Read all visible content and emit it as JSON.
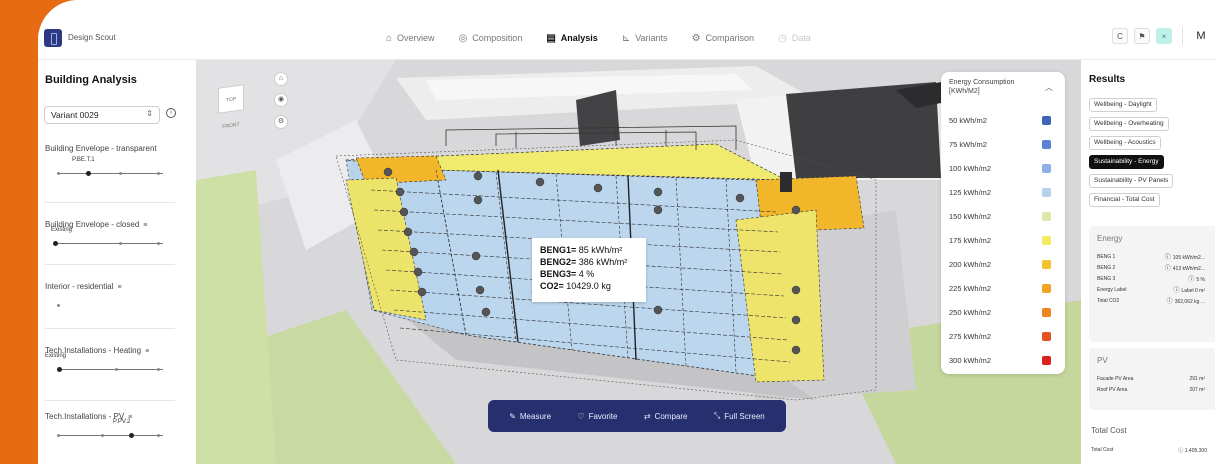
{
  "brand": {
    "name": "Design Scout"
  },
  "nav": [
    {
      "label": "Overview",
      "icon": "home-icon",
      "glyph": "⌂",
      "state": "normal"
    },
    {
      "label": "Composition",
      "icon": "layers-icon",
      "glyph": "◎",
      "state": "normal"
    },
    {
      "label": "Analysis",
      "icon": "analysis-icon",
      "glyph": "▤",
      "state": "active"
    },
    {
      "label": "Variants",
      "icon": "chart-icon",
      "glyph": "⊾",
      "state": "normal"
    },
    {
      "label": "Comparison",
      "icon": "compare-icon",
      "glyph": "⚙",
      "state": "normal"
    },
    {
      "label": "Data",
      "icon": "clock-icon",
      "glyph": "◷",
      "state": "disabled"
    }
  ],
  "toolbar": {
    "refresh": "C",
    "flag": "⚑",
    "close": "×",
    "user_initial": "M"
  },
  "left_panel": {
    "title": "Building Analysis",
    "variant": "Variant 0029",
    "params": [
      {
        "label": "Building Envelope - transparent",
        "value": "P.BE.T.1"
      },
      {
        "label": "Building Envelope - closed",
        "value": "Existing"
      },
      {
        "label": "Interior - residential",
        "value": ""
      },
      {
        "label": "Tech.Installations - Heating",
        "value": "Existing"
      },
      {
        "label": "Tech.Installations - PV",
        "value": "P.PV.2"
      }
    ]
  },
  "viewport": {
    "cube_label": "TOP FRONT",
    "tooltip": {
      "lines": [
        {
          "key": "BENG1=",
          "value": "85 kWh/m²"
        },
        {
          "key": "BENG2=",
          "value": "386 kWh/m²"
        },
        {
          "key": "BENG3=",
          "value": "4 %"
        },
        {
          "key": "CO2=",
          "value": "10429.0 kg"
        }
      ]
    },
    "legend": {
      "title": "Energy Consumption [KWh/M2]",
      "items": [
        {
          "label": "50 kWh/m2",
          "color": "#3f63b5"
        },
        {
          "label": "75 kWh/m2",
          "color": "#5b82d2"
        },
        {
          "label": "100 kWh/m2",
          "color": "#8fb0e6"
        },
        {
          "label": "125 kWh/m2",
          "color": "#b4d2ec"
        },
        {
          "label": "150 kWh/m2",
          "color": "#dce8a8"
        },
        {
          "label": "175 kWh/m2",
          "color": "#f2ec62"
        },
        {
          "label": "200 kWh/m2",
          "color": "#f3c22e"
        },
        {
          "label": "225 kWh/m2",
          "color": "#f1a524"
        },
        {
          "label": "250 kWh/m2",
          "color": "#ed8420"
        },
        {
          "label": "275 kWh/m2",
          "color": "#e3531d"
        },
        {
          "label": "300 kWh/m2",
          "color": "#d9231c"
        }
      ]
    },
    "actions": [
      {
        "label": "Measure",
        "icon": "ruler-icon",
        "glyph": "✎"
      },
      {
        "label": "Favorite",
        "icon": "heart-icon",
        "glyph": "♡"
      },
      {
        "label": "Compare",
        "icon": "compare-icon",
        "glyph": "⇄"
      },
      {
        "label": "Full Screen",
        "icon": "fullscreen-icon",
        "glyph": "⤡"
      }
    ]
  },
  "right_panel": {
    "title": "Results",
    "chips": [
      {
        "label": "Wellbeing - Daylight",
        "active": false
      },
      {
        "label": "Wellbeing - Overheating",
        "active": false
      },
      {
        "label": "Wellbeing - Acoustics",
        "active": false
      },
      {
        "label": "Sustainability - Energy",
        "active": true
      },
      {
        "label": "Sustainability - PV Panels",
        "active": false
      },
      {
        "label": "Financial - Total Cost",
        "active": false
      }
    ],
    "energy": {
      "title": "Energy",
      "rows": [
        {
          "key": "BENG 1",
          "value": "105 kWh/m2..."
        },
        {
          "key": "BENG 2",
          "value": "413 kWh/m2..."
        },
        {
          "key": "BENG 3",
          "value": "5 %"
        },
        {
          "key": "Energy Label",
          "value": "Label 0 m²"
        },
        {
          "key": "Total CO2",
          "value": "362,062 kg ..."
        }
      ]
    },
    "pv": {
      "title": "PV",
      "rows": [
        {
          "key": "Facade PV Area",
          "value": "291 m²"
        },
        {
          "key": "Roof PV Area",
          "value": "207 m²"
        }
      ]
    },
    "total_cost": {
      "title": "Total Cost",
      "key": "Total Cost",
      "value": "1.405.300"
    }
  }
}
